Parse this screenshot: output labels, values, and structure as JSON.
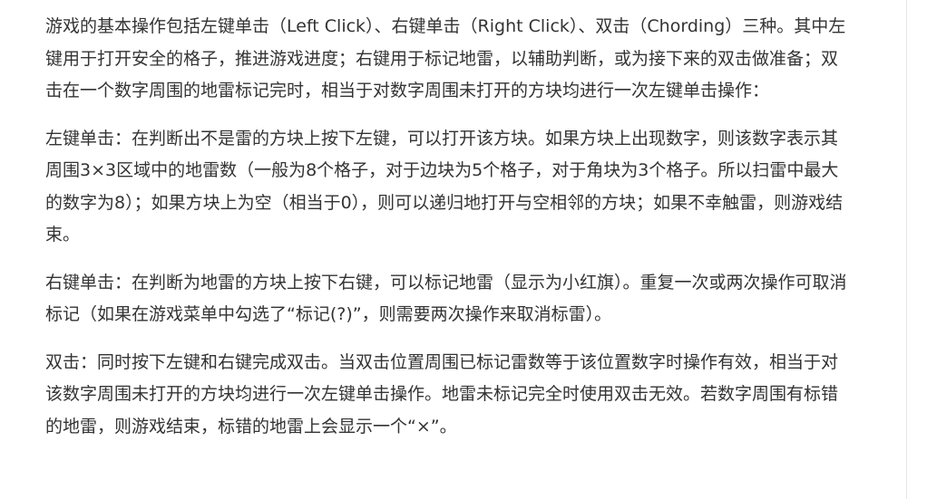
{
  "article": {
    "paragraphs": [
      "游戏的基本操作包括左键单击（Left Click）、右键单击（Right Click）、双击（Chording）三种。其中左键用于打开安全的格子，推进游戏进度；右键用于标记地雷，以辅助判断，或为接下来的双击做准备；双击在一个数字周围的地雷标记完时，相当于对数字周围未打开的方块均进行一次左键单击操作：",
      "左键单击：在判断出不是雷的方块上按下左键，可以打开该方块。如果方块上出现数字，则该数字表示其周围3×3区域中的地雷数（一般为8个格子，对于边块为5个格子，对于角块为3个格子。所以扫雷中最大的数字为8）；如果方块上为空（相当于0），则可以递归地打开与空相邻的方块；如果不幸触雷，则游戏结束。",
      "右键单击：在判断为地雷的方块上按下右键，可以标记地雷（显示为小红旗）。重复一次或两次操作可取消标记（如果在游戏菜单中勾选了“标记(?)”，则需要两次操作来取消标雷）。",
      "双击：同时按下左键和右键完成双击。当双击位置周围已标记雷数等于该位置数字时操作有效，相当于对该数字周围未打开的方块均进行一次左键单击操作。地雷未标记完全时使用双击无效。若数字周围有标错的地雷，则游戏结束，标错的地雷上会显示一个“×”。"
    ]
  }
}
